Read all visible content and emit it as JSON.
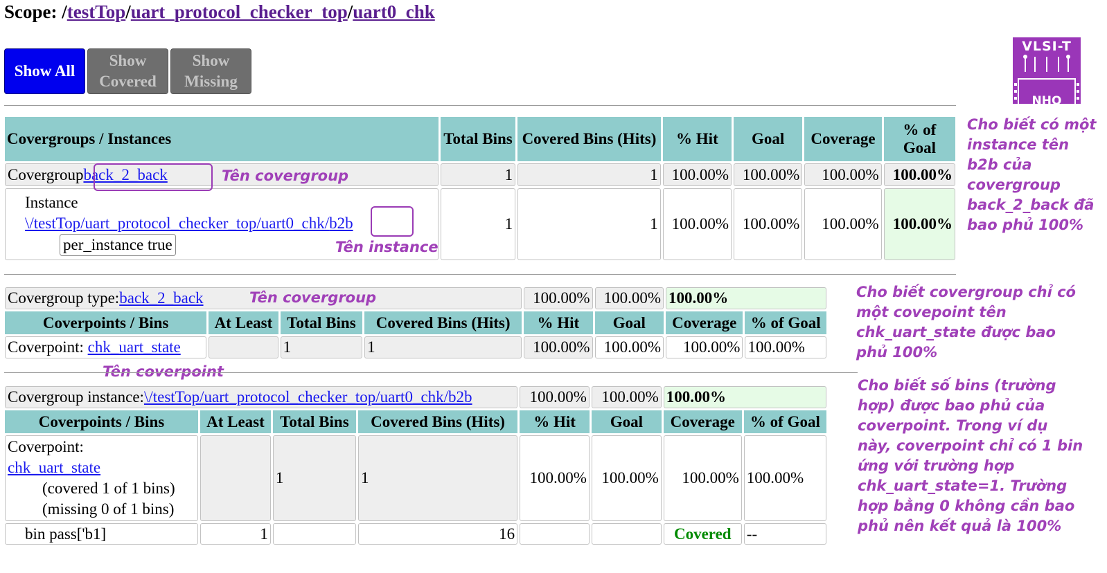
{
  "scope": {
    "label": "Scope: /",
    "crumbs": [
      "testTop",
      "uart_protocol_checker_top",
      "uart0_chk"
    ]
  },
  "buttons": {
    "show_all": "Show All",
    "show_covered": "Show Covered",
    "show_missing": "Show Missing"
  },
  "logo": {
    "text": "VLSI-T",
    "sub": "NHO"
  },
  "table1": {
    "headers": [
      "Covergroups / Instances",
      "Total Bins",
      "Covered Bins (Hits)",
      "% Hit",
      "Goal",
      "Coverage",
      "% of Goal"
    ],
    "row1": {
      "label": "Covergroup",
      "link": "back_2_back",
      "total": "1",
      "covered": "1",
      "hit": "100.00%",
      "goal": "100.00%",
      "coverage": "100.00%",
      "pct_goal": "100.00%"
    },
    "row2": {
      "label": "Instance",
      "path": "\\/testTop/uart_protocol_checker_top/uart0_chk/",
      "inst": "b2b",
      "option": "per_instance true",
      "total": "1",
      "covered": "1",
      "hit": "100.00%",
      "goal": "100.00%",
      "coverage": "100.00%",
      "pct_goal": "100.00%"
    }
  },
  "table2": {
    "type_label": "Covergroup type:",
    "type_link": "back_2_back",
    "summary": [
      "100.00%",
      "100.00%",
      "100.00%"
    ],
    "headers": [
      "Coverpoints / Bins",
      "At Least",
      "Total Bins",
      "Covered Bins (Hits)",
      "% Hit",
      "Goal",
      "Coverage",
      "% of Goal"
    ],
    "row": {
      "label": "Coverpoint: ",
      "link": "chk_uart_state",
      "at_least": "",
      "total": "1",
      "covered": "1",
      "hit": "100.00%",
      "goal": "100.00%",
      "coverage": "100.00%",
      "pct_goal": "100.00%"
    }
  },
  "table3": {
    "inst_label": "Covergroup instance:",
    "inst_link": "\\/testTop/uart_protocol_checker_top/uart0_chk/b2b",
    "summary": [
      "100.00%",
      "100.00%",
      "100.00%"
    ],
    "headers": [
      "Coverpoints / Bins",
      "At Least",
      "Total Bins",
      "Covered Bins (Hits)",
      "% Hit",
      "Goal",
      "Coverage",
      "% of Goal"
    ],
    "row": {
      "label": "Coverpoint:",
      "link": "chk_uart_state",
      "covered_note": "(covered 1 of 1 bins)",
      "missing_note": "(missing 0 of 1 bins)",
      "total": "1",
      "covered": "1",
      "hit": "100.00%",
      "goal": "100.00%",
      "coverage": "100.00%",
      "pct_goal": "100.00%"
    },
    "bin": {
      "name": "bin pass['b1]",
      "at_least": "1",
      "hits": "16",
      "status": "Covered",
      "pct_goal": "--"
    }
  },
  "annotations": {
    "covergroup_name_1": "Tên covergroup",
    "instance_name": "Tên instance",
    "covergroup_name_2": "Tên covergroup",
    "coverpoint_name": "Tên coverpoint",
    "note1": "Cho biết có một instance tên b2b của covergroup back_2_back đã bao phủ 100%",
    "note2": "Cho biết covergroup chỉ có một covepoint tên chk_uart_state được bao phủ 100%",
    "note3": "Cho biết số bins (trường hợp) được bao phủ của coverpoint. Trong ví dụ này, coverpoint chỉ có 1 bin ứng với trường hợp chk_uart_state=1. Trường hợp bằng 0 không cần bao phủ nên kết quả là 100%"
  },
  "colors": {
    "header_bg": "#8fcccc",
    "annotation": "#a040b8",
    "show_all_bg": "#0000ee",
    "covered_text": "#008a00"
  }
}
